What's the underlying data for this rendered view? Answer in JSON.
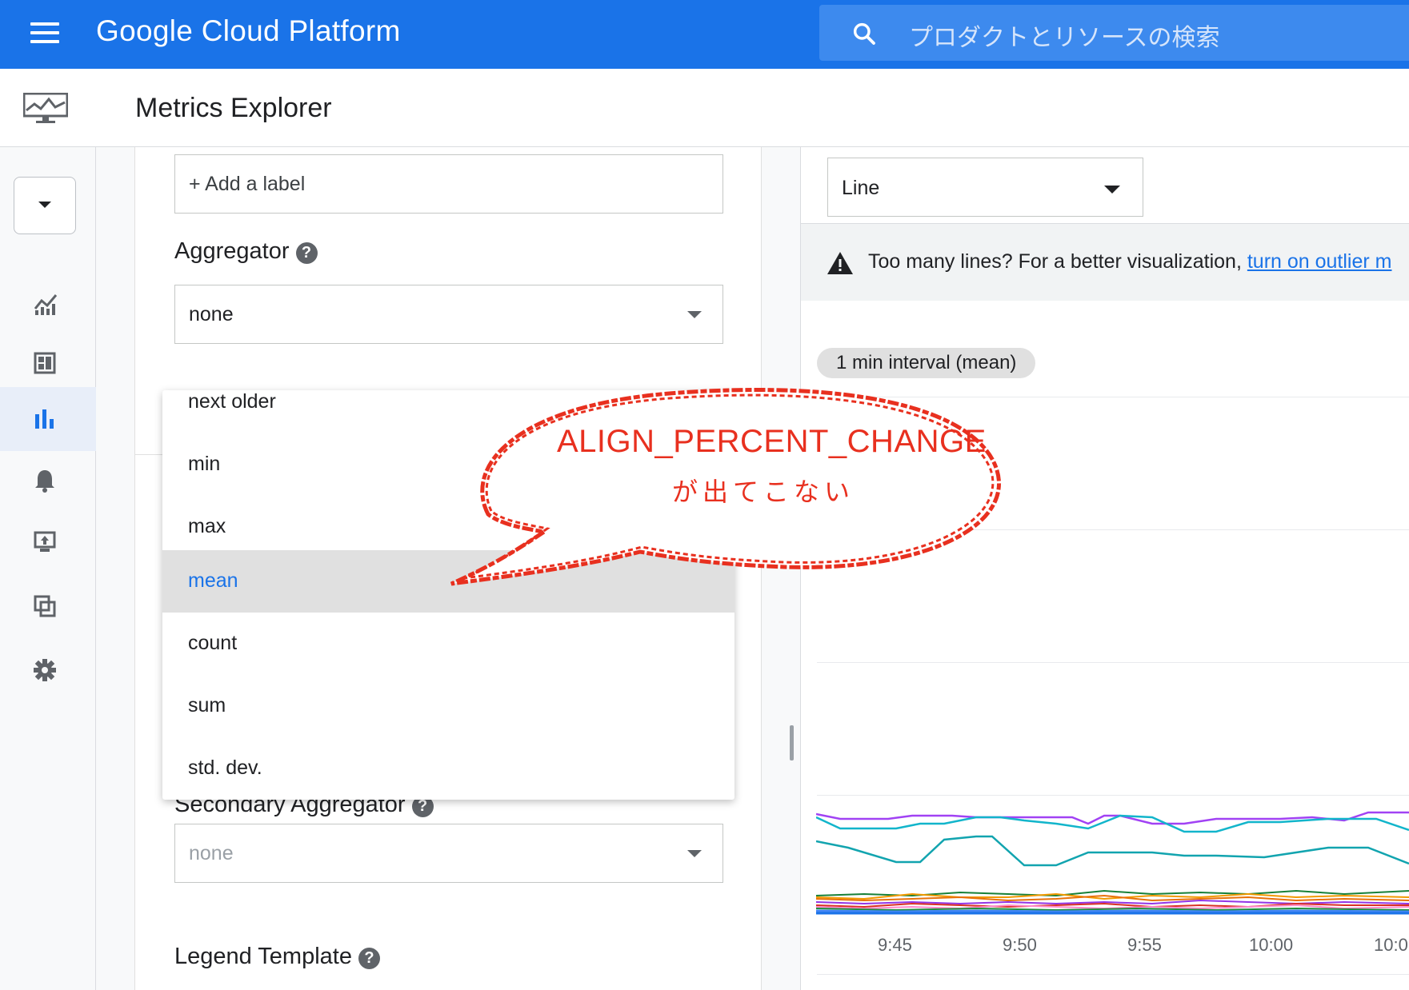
{
  "topbar": {
    "brand": "Google Cloud Platform",
    "search_placeholder": "プロダクトとリソースの検索"
  },
  "header": {
    "title": "Metrics Explorer"
  },
  "config": {
    "add_label": "+ Add a label",
    "aggregator_label": "Aggregator",
    "aggregator_value": "none",
    "secondary_aggregator_label": "Secondary Aggregator",
    "secondary_aggregator_value": "none",
    "legend_template_label": "Legend Template"
  },
  "menu": {
    "items": [
      {
        "label": "next older"
      },
      {
        "label": "min"
      },
      {
        "label": "max"
      },
      {
        "label": "mean",
        "selected": true
      },
      {
        "label": "count"
      },
      {
        "label": "sum"
      },
      {
        "label": "std. dev."
      }
    ]
  },
  "chart": {
    "type_value": "Line",
    "warning_text": "Too many lines? For a better visualization, ",
    "warning_link": "turn on outlier m",
    "interval": "1 min interval (mean)",
    "x_ticks": [
      "9:45",
      "9:50",
      "9:55",
      "10:00",
      "10:0"
    ]
  },
  "annotation": {
    "line1": "ALIGN_PERCENT_CHANGE",
    "line2": "が出てこない"
  },
  "colors": {
    "brand": "#1a73e8",
    "callout": "#e8301f"
  }
}
